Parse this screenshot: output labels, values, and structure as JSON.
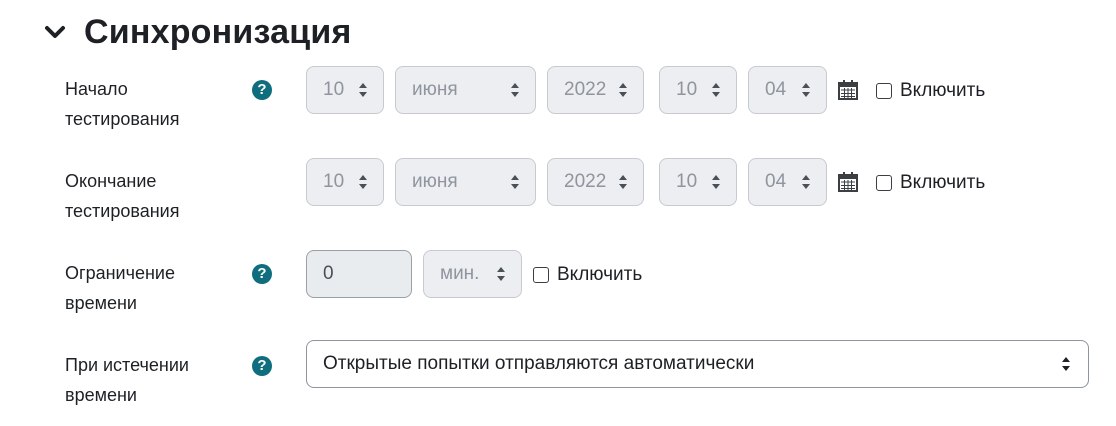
{
  "section": {
    "title": "Синхронизация",
    "expand_icon": "chevron-down-icon"
  },
  "open": {
    "label": "Начало тестирования",
    "day": "10",
    "month": "июня",
    "year": "2022",
    "hour": "10",
    "minute": "04",
    "enable_label": "Включить"
  },
  "close": {
    "label": "Окончание тестирования",
    "day": "10",
    "month": "июня",
    "year": "2022",
    "hour": "10",
    "minute": "04",
    "enable_label": "Включить"
  },
  "timelimit": {
    "label": "Ограничение времени",
    "value": "0",
    "unit": "мин.",
    "enable_label": "Включить"
  },
  "overdue": {
    "label": "При истечении времени",
    "value": "Открытые попытки отправляются автоматически"
  },
  "help_glyph": "?",
  "colors": {
    "help": "#0f6e7d",
    "disabled_bg": "#eceef1",
    "text": "#1d2125"
  }
}
